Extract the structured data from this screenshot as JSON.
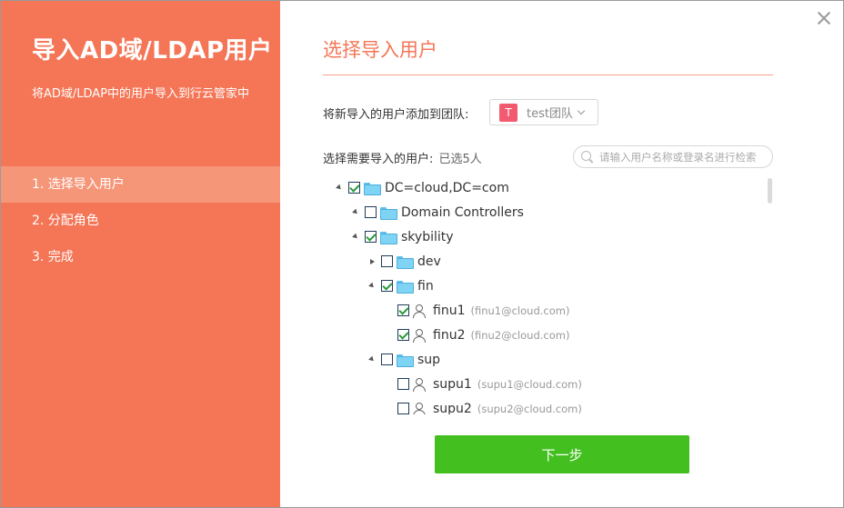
{
  "sidebar": {
    "title": "导入AD域/LDAP用户",
    "description": "将AD域/LDAP中的用户导入到行云管家中",
    "steps": [
      {
        "label": "1. 选择导入用户",
        "active": true
      },
      {
        "label": "2. 分配角色",
        "active": false
      },
      {
        "label": "3. 完成",
        "active": false
      }
    ]
  },
  "main": {
    "section_title": "选择导入用户",
    "team_label": "将新导入的用户添加到团队:",
    "team": {
      "badge": "T",
      "name": "test团队"
    },
    "users_label": "选择需要导入的用户:",
    "selected_count": "已选5人",
    "search": {
      "placeholder": "请输入用户名称或登录名进行检索",
      "value": ""
    },
    "tree": [
      {
        "label": "DC=cloud,DC=com",
        "type": "folder",
        "depth": 0,
        "toggle": "open",
        "checked": true
      },
      {
        "label": "Domain Controllers",
        "type": "folder",
        "depth": 1,
        "toggle": "open",
        "checked": false
      },
      {
        "label": "skybility",
        "type": "folder",
        "depth": 1,
        "toggle": "open",
        "checked": true
      },
      {
        "label": "dev",
        "type": "folder",
        "depth": 2,
        "toggle": "closed",
        "checked": false
      },
      {
        "label": "fin",
        "type": "folder",
        "depth": 2,
        "toggle": "open",
        "checked": true
      },
      {
        "label": "finu1",
        "sub": "(finu1@cloud.com)",
        "type": "user",
        "depth": 3,
        "toggle": "none",
        "checked": true
      },
      {
        "label": "finu2",
        "sub": "(finu2@cloud.com)",
        "type": "user",
        "depth": 3,
        "toggle": "none",
        "checked": true
      },
      {
        "label": "sup",
        "type": "folder",
        "depth": 2,
        "toggle": "open",
        "checked": false
      },
      {
        "label": "supu1",
        "sub": "(supu1@cloud.com)",
        "type": "user",
        "depth": 3,
        "toggle": "none",
        "checked": false
      },
      {
        "label": "supu2",
        "sub": "(supu2@cloud.com)",
        "type": "user",
        "depth": 3,
        "toggle": "none",
        "checked": false
      }
    ],
    "next_label": "下一步"
  },
  "icons": {
    "close": "close-icon",
    "search": "search-icon",
    "folder": "folder-icon",
    "user": "user-icon",
    "dropdown": "chevron-down-icon"
  },
  "colors": {
    "sidebar_bg": "#f47656",
    "sidebar_active": "#f69679",
    "accent": "#f47656",
    "primary_button": "#43c01f",
    "team_badge": "#f25a6f",
    "folder": "#7fd3f4"
  }
}
